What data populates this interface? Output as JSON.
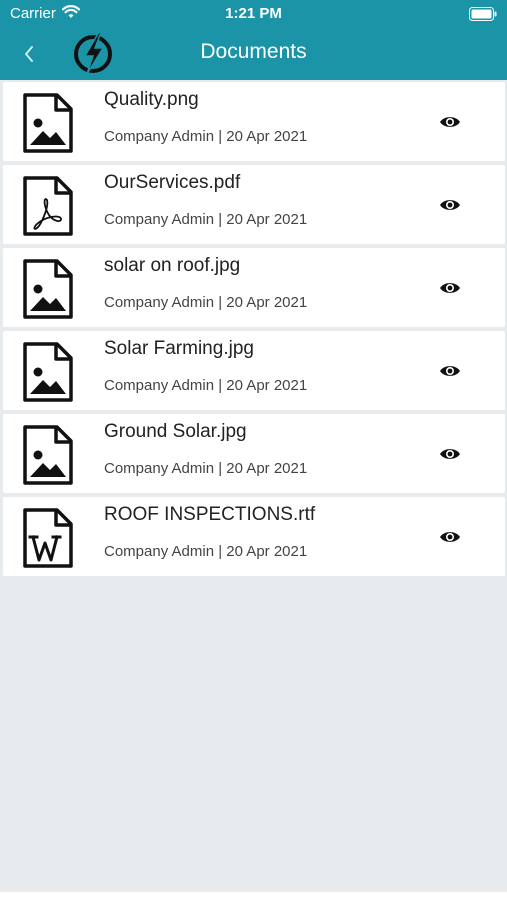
{
  "status_bar": {
    "carrier": "Carrier",
    "time": "1:21 PM"
  },
  "nav": {
    "title": "Documents",
    "back_icon": "chevron-left-icon",
    "logo_icon": "lightning-logo-icon"
  },
  "colors": {
    "header": "#1b94a8",
    "background": "#e8ebee",
    "row": "#ffffff"
  },
  "documents": [
    {
      "name": "Quality.png",
      "meta": "Company Admin | 20 Apr 2021",
      "icon": "image-file-icon"
    },
    {
      "name": "OurServices.pdf",
      "meta": "Company Admin | 20 Apr 2021",
      "icon": "pdf-file-icon"
    },
    {
      "name": "solar on roof.jpg",
      "meta": "Company Admin | 20 Apr 2021",
      "icon": "image-file-icon"
    },
    {
      "name": "Solar Farming.jpg",
      "meta": "Company Admin | 20 Apr 2021",
      "icon": "image-file-icon"
    },
    {
      "name": "Ground Solar.jpg",
      "meta": "Company Admin | 20 Apr 2021",
      "icon": "image-file-icon"
    },
    {
      "name": "ROOF INSPECTIONS.rtf",
      "meta": "Company Admin | 20 Apr 2021",
      "icon": "word-file-icon"
    }
  ]
}
